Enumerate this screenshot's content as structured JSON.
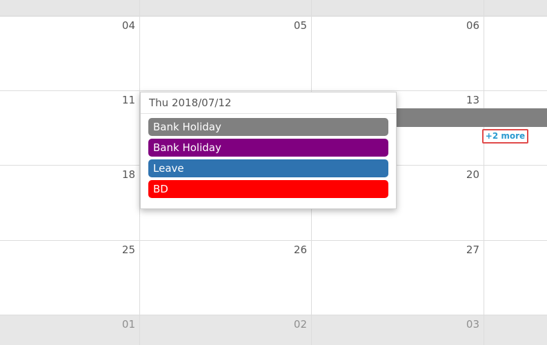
{
  "calendar": {
    "weeks": [
      {
        "days": [
          {
            "num": "04",
            "other": false
          },
          {
            "num": "05",
            "other": false
          },
          {
            "num": "06",
            "other": false
          }
        ]
      },
      {
        "days": [
          {
            "num": "11",
            "other": false
          },
          {
            "num": "",
            "other": false
          },
          {
            "num": "13",
            "other": false
          }
        ]
      },
      {
        "days": [
          {
            "num": "18",
            "other": false
          },
          {
            "num": "",
            "other": false
          },
          {
            "num": "20",
            "other": false
          }
        ]
      },
      {
        "days": [
          {
            "num": "25",
            "other": false
          },
          {
            "num": "26",
            "other": false
          },
          {
            "num": "27",
            "other": false
          }
        ]
      },
      {
        "days": [
          {
            "num": "01",
            "other": true
          },
          {
            "num": "02",
            "other": true
          },
          {
            "num": "03",
            "other": true
          }
        ]
      }
    ],
    "more_link": "+2 more",
    "allday_bar_color": "#808080"
  },
  "popover": {
    "title": "Thu 2018/07/12",
    "events": [
      {
        "label": "Bank Holiday",
        "color": "#808080"
      },
      {
        "label": "Bank Holiday",
        "color": "#800080"
      },
      {
        "label": "Leave",
        "color": "#2f73b0"
      },
      {
        "label": "BD",
        "color": "#ff0000"
      }
    ]
  }
}
